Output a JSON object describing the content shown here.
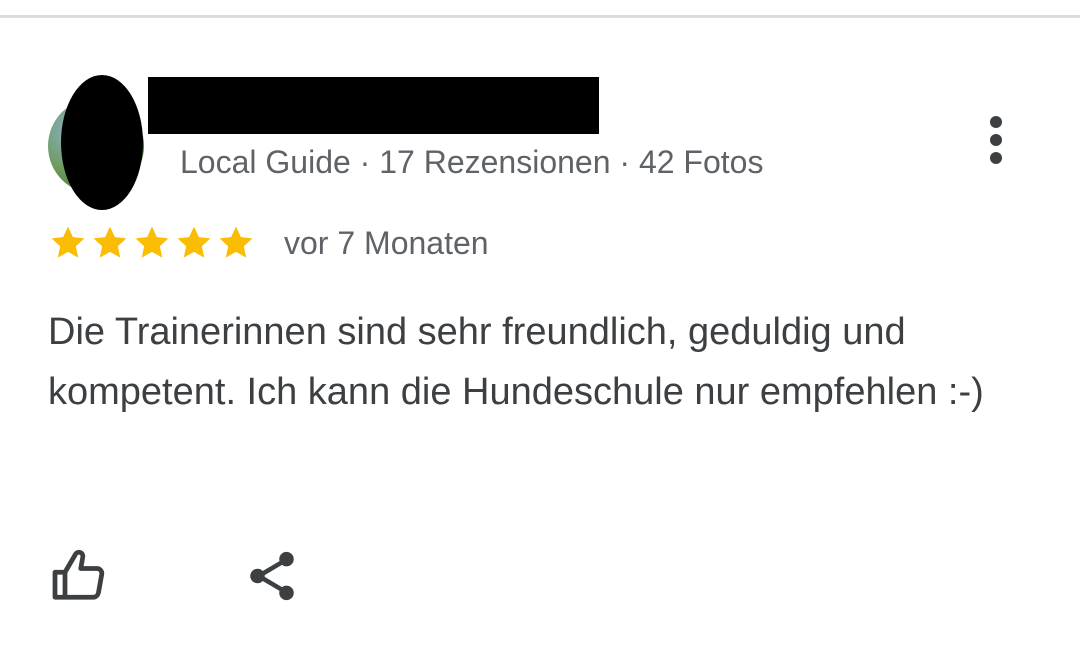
{
  "review": {
    "reviewer_meta": "Local Guide · 17 Rezensionen · 42 Fotos",
    "rating": 5,
    "rating_max": 5,
    "date": "vor 7 Monaten",
    "text": "Die Trainerinnen sind sehr freundlich, geduldig und kompetent. Ich kann die Hundeschule nur empfehlen :-)"
  },
  "icons": {
    "more": "more-vert-icon",
    "like": "thumb-up-icon",
    "share": "share-icon",
    "star": "star-icon"
  },
  "colors": {
    "star": "#fbbc04",
    "meta_text": "#5f6368",
    "body_text": "#3c4043",
    "icon": "#3c4043",
    "redaction": "#000000"
  }
}
